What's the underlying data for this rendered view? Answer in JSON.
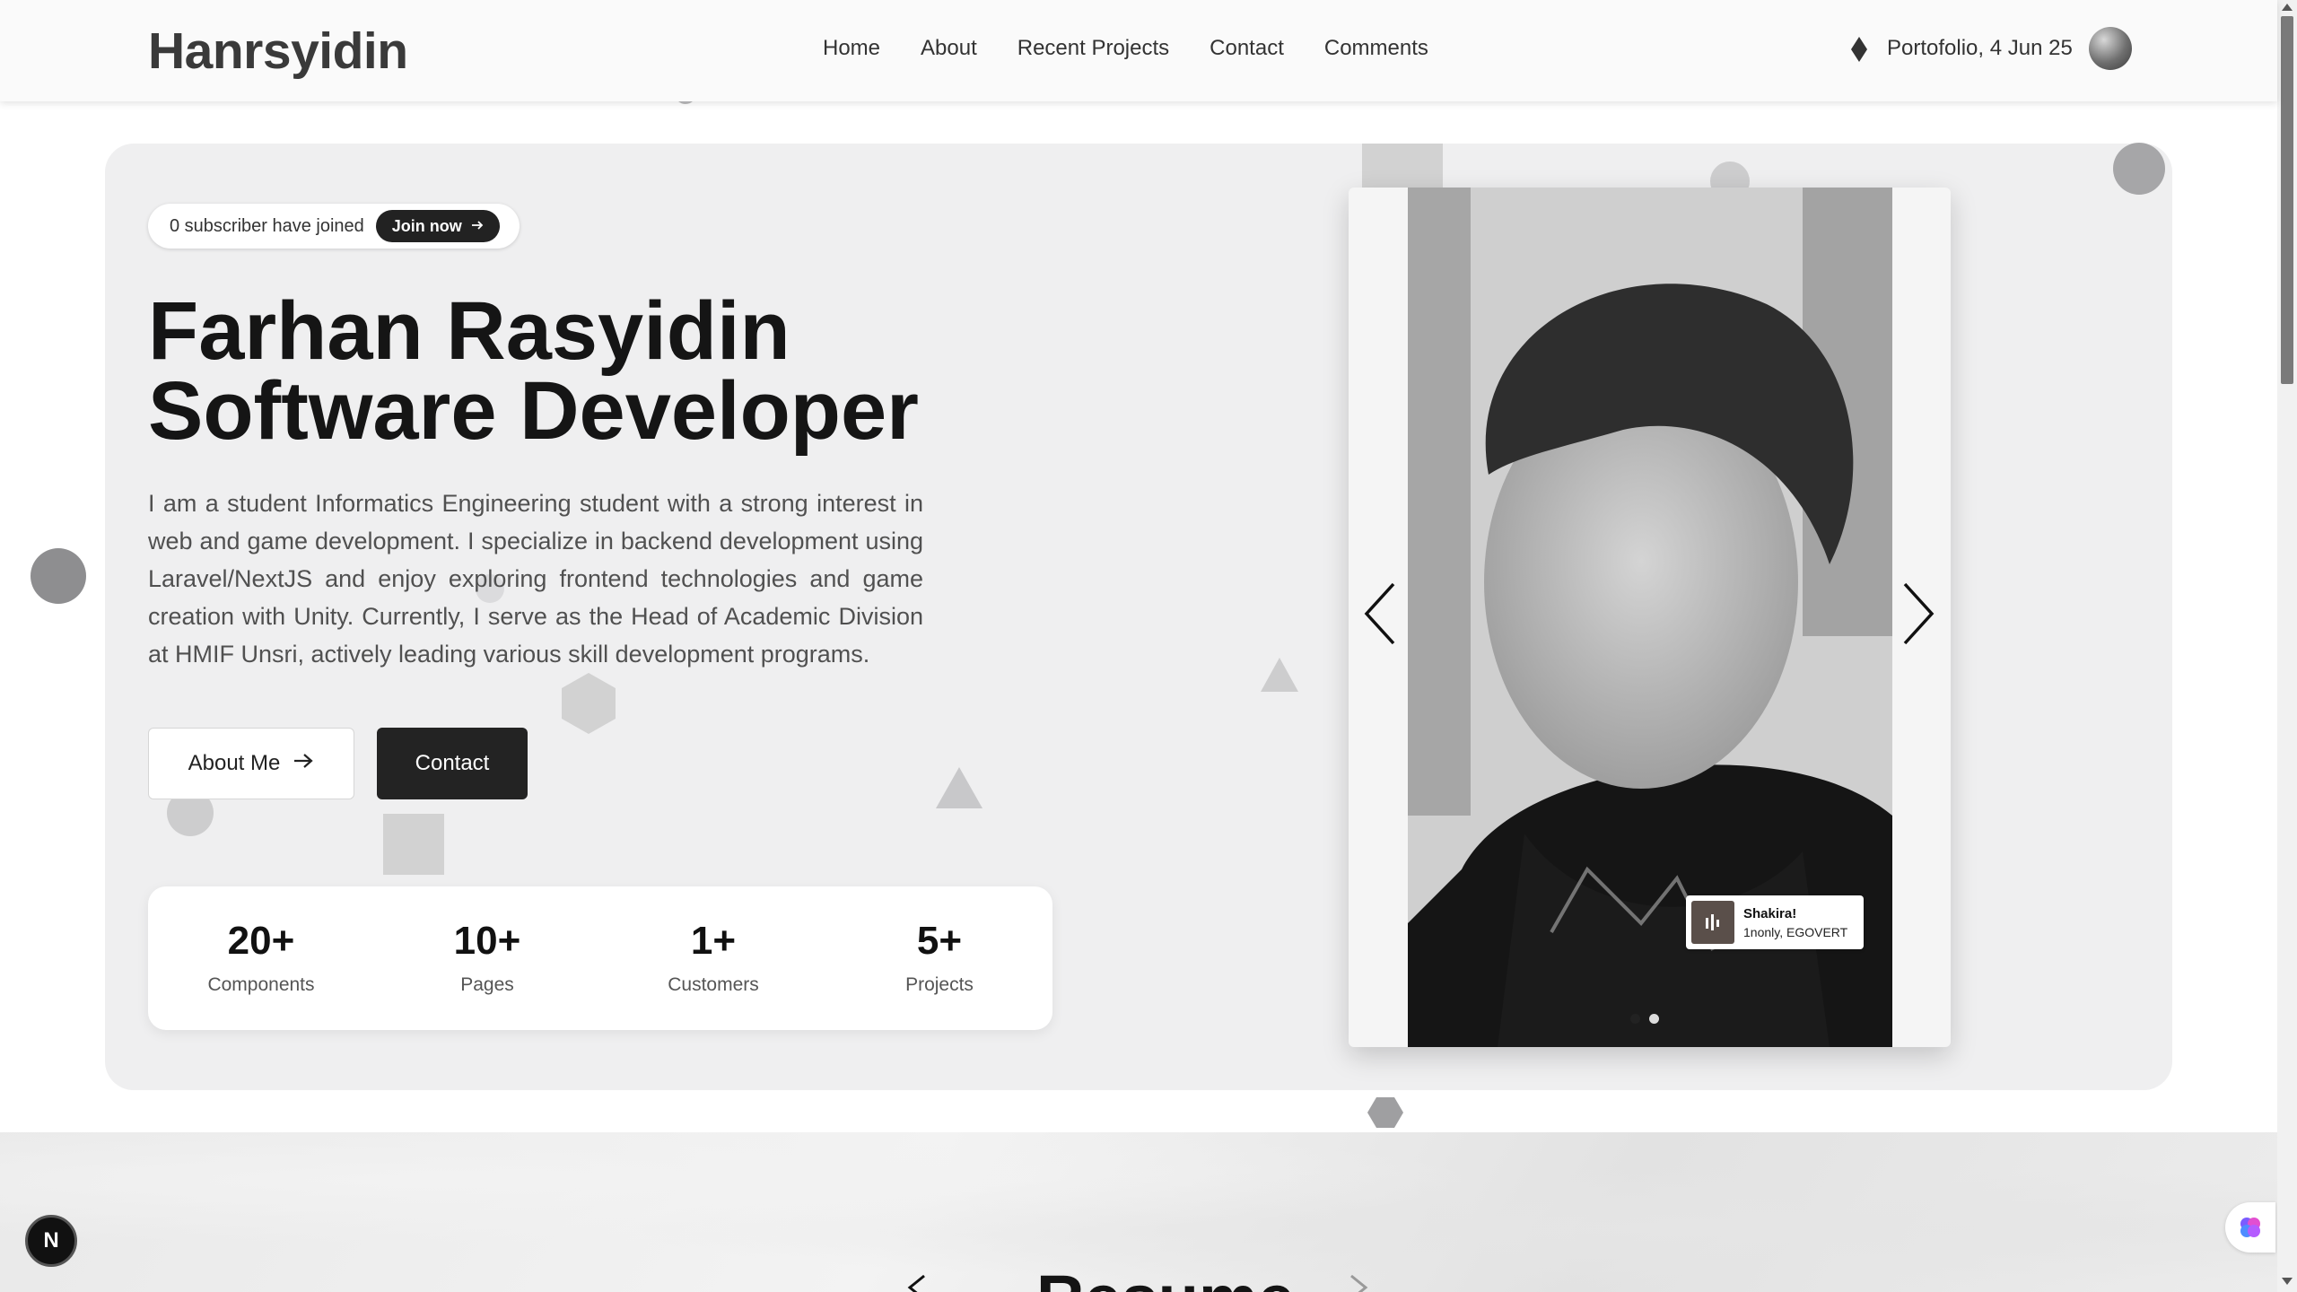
{
  "nav": {
    "brand": "Hanrsyidin",
    "links": [
      "Home",
      "About",
      "Recent Projects",
      "Contact",
      "Comments"
    ],
    "date_label": "Portofolio, 4 Jun 25",
    "diamond_icon": "diamond-icon",
    "avatar_icon": "avatar"
  },
  "hero": {
    "subscriber_text": "0 subscriber have joined",
    "join_label": "Join now",
    "title_line1": "Farhan Rasyidin",
    "title_line2": "Software Developer",
    "description": "I am a student Informatics Engineering student with a strong interest in web and game development. I specialize in backend development using Laravel/NextJS and enjoy exploring frontend technologies and game creation with Unity. Currently, I serve as the Head of Academic Division at HMIF Unsri, actively leading various skill development programs.",
    "about_button": "About Me",
    "contact_button": "Contact",
    "stats": [
      {
        "value": "20+",
        "label": "Components"
      },
      {
        "value": "10+",
        "label": "Pages"
      },
      {
        "value": "1+",
        "label": "Customers"
      },
      {
        "value": "5+",
        "label": "Projects"
      }
    ]
  },
  "carousel": {
    "music_title": "Shakira!",
    "music_artist": "1nonly, EGOVERT",
    "slides": 2,
    "active_slide": 1
  },
  "resume": {
    "title": "Resume"
  },
  "floating": {
    "next_badge": "N"
  },
  "colors": {
    "dark": "#222222",
    "hero_bg": "#efeff0",
    "shape": "#8e8e90"
  }
}
